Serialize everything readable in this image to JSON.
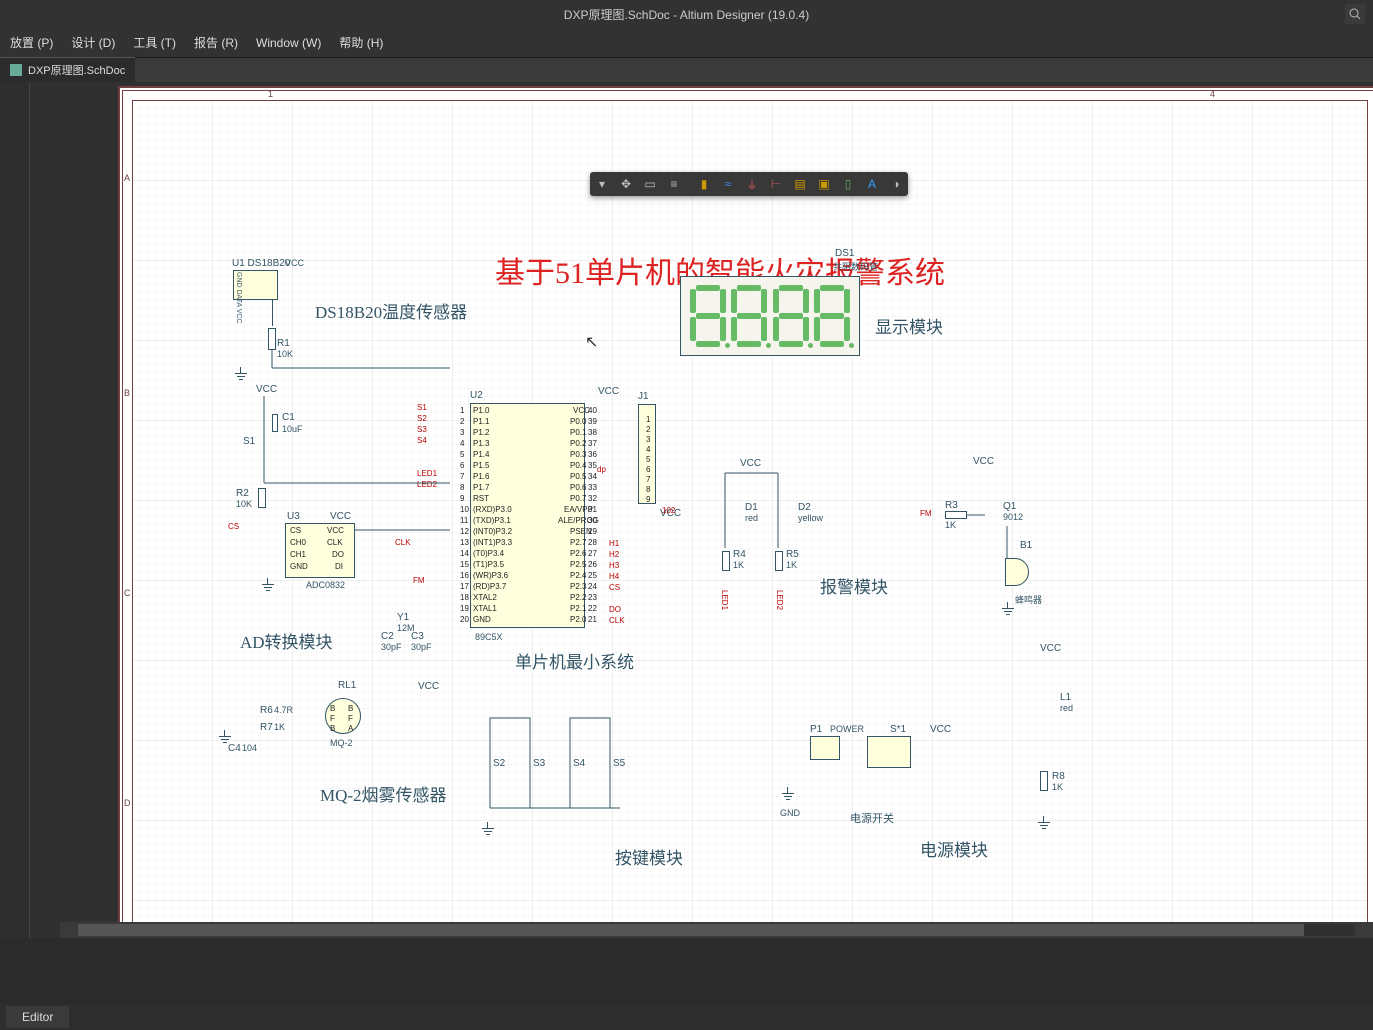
{
  "title": "DXP原理图.SchDoc - Altium Designer (19.0.4)",
  "menu": {
    "m0": "放置 (P)",
    "m1": "设计 (D)",
    "m2": "工具 (T)",
    "m3": "报告 (R)",
    "m4": "Window (W)",
    "m5": "帮助 (H)"
  },
  "tab": "DXP原理图.SchDoc",
  "schematic_title": "基于51单片机的智能火灾报警系统",
  "modules": {
    "ds18b20": "DS18B20温度传感器",
    "ad": "AD转换模块",
    "mcu": "单片机最小系统",
    "mq2": "MQ-2烟雾传感器",
    "disp": "显示模块",
    "key": "按键模块",
    "alarm": "报警模块",
    "pwr": "电源模块",
    "pwrsw": "电源开关"
  },
  "components": {
    "u1": "U1 DS18B20",
    "u1_vcc": "VCC",
    "u1_pins": "GND DATA VCC",
    "r1": "R1",
    "r1v": "10K",
    "c1": "C1",
    "c1v": "10uF",
    "s1": "S1",
    "r2": "R2",
    "r2v": "10K",
    "u3": "U3",
    "adc": "ADC0832",
    "u3_vcc": "VCC",
    "u2": "U2",
    "mcu_part": "89C5X",
    "j1": "J1",
    "j1_vcc": "VCC",
    "y1": "Y1",
    "y1v": "12M",
    "c2": "C2",
    "c2v": "30pF",
    "c3": "C3",
    "c3v": "30pF",
    "rl1": "RL1",
    "mq2": "MQ-2",
    "r6": "R6",
    "r6v": "4.7R",
    "r7": "R7",
    "r7v": "1K",
    "c4": "C4",
    "c4v": "104",
    "ds1": "DS1",
    "ds1_t": "共阴数码管",
    "d1": "D1",
    "d1c": "red",
    "d2": "D2",
    "d2c": "yellow",
    "r3": "R3",
    "r3v": "1K",
    "r4": "R4",
    "r4v": "1K",
    "r5": "R5",
    "r5v": "1K",
    "q1": "Q1",
    "q1p": "9012",
    "b1": "B1",
    "buzzer": "蜂鸣器",
    "p1": "P1",
    "p1l": "POWER",
    "sw": "S*1",
    "l1": "L1",
    "l1c": "red",
    "r8": "R8",
    "r8v": "1K",
    "s2": "S2",
    "s3": "S3",
    "s4": "S4",
    "s5": "S5",
    "gnd_l": "GND",
    "vcc": "VCC",
    "adc_pins": {
      "cs": "CS",
      "ch0": "CH0",
      "ch1": "CH1",
      "gndp": "GND",
      "vccp": "VCC",
      "clkp": "CLK",
      "dop": "DO",
      "dip": "DI"
    },
    "mcu_left": [
      "P1.0",
      "P1.1",
      "P1.2",
      "P1.3",
      "P1.4",
      "P1.5",
      "P1.6",
      "P1.7",
      "RST",
      "(RXD)P3.0",
      "(TXD)P3.1",
      "(INT0)P3.2",
      "(INT1)P3.3",
      "(T0)P3.4",
      "(T1)P3.5",
      "(WR)P3.6",
      "(RD)P3.7",
      "XTAL2",
      "XTAL1",
      "GND"
    ],
    "mcu_right": [
      "VCC",
      "P0.0",
      "P0.1",
      "P0.2",
      "P0.3",
      "P0.4",
      "P0.5",
      "P0.6",
      "P0.7",
      "EA/VPP",
      "ALE/PROG",
      "PSEN",
      "P2.7",
      "P2.6",
      "P2.5",
      "P2.4",
      "P2.3",
      "P2.2",
      "P2.1",
      "P2.0"
    ],
    "nets": {
      "cs": "CS",
      "clk": "CLK",
      "do": "DO",
      "fm": "FM",
      "led1": "LED1",
      "led2": "LED2",
      "s1n": "S1",
      "s2n": "S2",
      "s3n": "S3",
      "s4n": "S4",
      "dp": "dp",
      "102": "102",
      "h1": "H1",
      "h2": "H2",
      "h3": "H3",
      "h4": "H4"
    }
  },
  "status": "Editor",
  "ruler_cols": [
    "1",
    "4"
  ],
  "ruler_rows": [
    "A",
    "B",
    "C",
    "D"
  ]
}
